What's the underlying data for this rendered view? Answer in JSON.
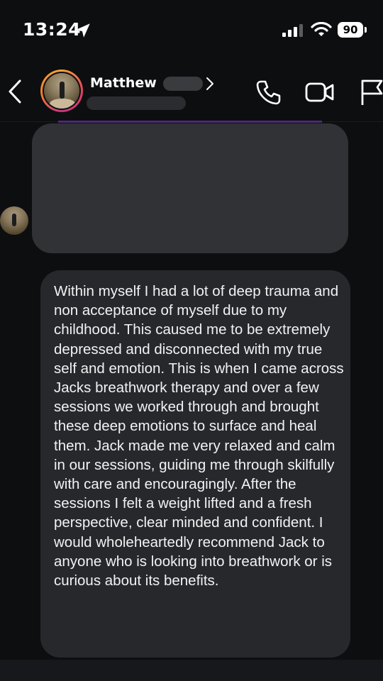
{
  "status_bar": {
    "time": "13:24",
    "battery": "90",
    "icons": [
      "location-arrow-icon",
      "signal-icon",
      "wifi-icon",
      "battery-icon"
    ]
  },
  "header": {
    "contact_name": "Matthew",
    "icons": [
      "back-icon",
      "chevron-right-icon",
      "phone-icon",
      "video-icon",
      "flag-icon"
    ]
  },
  "messages": [
    {
      "text": "Within myself I had a lot of deep trauma and non acceptance of myself due to my childhood. This caused me to be extremely depressed and disconnected with my true self and emotion. This is when I came across Jacks breathwork therapy and over a few sessions we worked through and brought these deep emotions to surface and heal them. Jack made me very relaxed and calm in our sessions, guiding me through skilfully with care and encouragingly. After the sessions I felt a weight lifted and a fresh perspective, clear minded and confident. I would wholeheartedly recommend Jack to anyone who is looking into breathwork or is curious about its benefits."
    }
  ],
  "colors": {
    "background": "#0d0e10",
    "bubble": "#27282c",
    "redacted": "#313236",
    "accent_ring": "#e4405f"
  }
}
